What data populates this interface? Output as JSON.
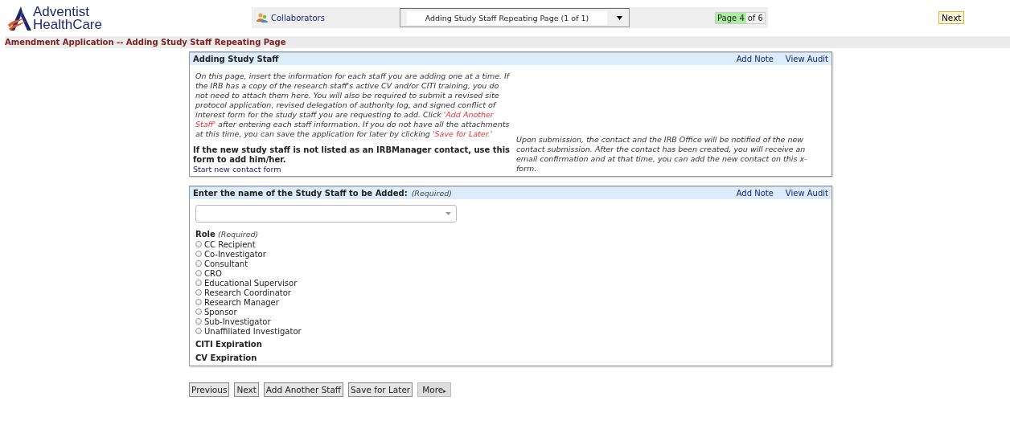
{
  "logo": {
    "line1": "Adventist",
    "line2": "HealthCare"
  },
  "toolbar": {
    "collaborators": "Collaborators",
    "page_select": "Adding Study Staff Repeating Page (1 of 1)",
    "page_current": "Page 4",
    "page_total": "of 6",
    "next": "Next"
  },
  "page_title": "Amendment Application -- Adding Study Staff Repeating Page",
  "panels": [
    {
      "title": "Adding Study Staff",
      "actions": [
        "Add Note",
        "View Audit"
      ],
      "kind": "info",
      "instructions": [
        {
          "text": "On this page, insert the information for each staff you are adding one at a time. If the IRB has a copy of the research staff's active CV and/or CITI training, you do not need to attach them here. You will also be required to submit a revised site protocol application, revised delegation of authority log, and signed conflict of interest form for the study staff you are requesting to add. Click ",
          "kind": "plain"
        },
        {
          "text": "'Add Another Staff'",
          "kind": "highlight"
        },
        {
          "text": " after entering each staff information. If you do not have all the attachments at this time, you can save the application for later by clicking ",
          "kind": "plain"
        },
        {
          "text": "'Save for Later.'",
          "kind": "highlight"
        }
      ],
      "contact_prompt": "If the new study staff is not listed as an IRBManager contact, use this form to add him/her.",
      "contact_link": "Start new contact form",
      "note": "Upon submission, the contact and the IRB Office will be notified of the new contact submission. After the contact has been created, you will receive an email confirmation and at that time, you can add the new contact on this x-form."
    },
    {
      "title": "Enter the name of the Study Staff to be Added:",
      "required": "(Required)",
      "actions": [
        "Add Note",
        "View Audit"
      ],
      "kind": "form",
      "role_label": "Role",
      "role_required": "(Required)",
      "roles": [
        {
          "label": "CC Recipient",
          "selected": false
        },
        {
          "label": "Co-Investigator",
          "selected": false
        },
        {
          "label": "Consultant",
          "selected": false
        },
        {
          "label": "CRO",
          "selected": false
        },
        {
          "label": "Educational Supervisor",
          "selected": false
        },
        {
          "label": "Research Coordinator",
          "selected": false
        },
        {
          "label": "Research Manager",
          "selected": false
        },
        {
          "label": "Sponsor",
          "selected": false
        },
        {
          "label": "Sub-Investigator",
          "selected": false
        },
        {
          "label": "Unaffiliated Investigator",
          "selected": false
        }
      ],
      "fields": [
        "CITI Expiration",
        "CV Expiration"
      ]
    }
  ],
  "buttons": [
    {
      "label": "Previous",
      "kind": "plain"
    },
    {
      "label": "Next",
      "kind": "plain"
    },
    {
      "label": "Add Another Staff",
      "kind": "plain"
    },
    {
      "label": "Save for Later",
      "kind": "plain"
    },
    {
      "label": "More",
      "kind": "menu",
      "caret": "▸"
    }
  ]
}
